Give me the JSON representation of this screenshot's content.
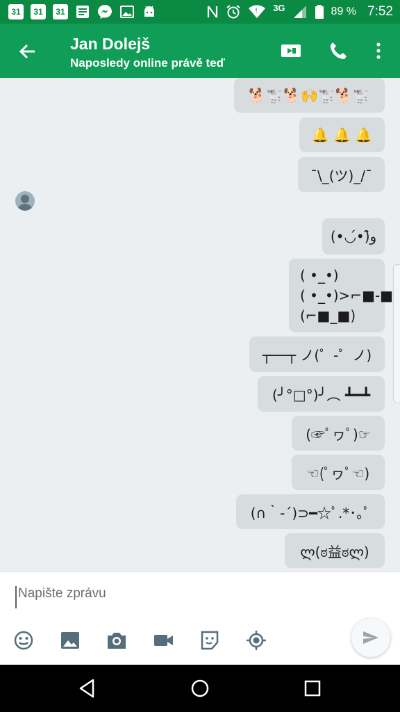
{
  "status_bar": {
    "calendar_day": "31",
    "network": "3G",
    "battery": "89 %",
    "time": "7:52",
    "left_icons": [
      "calendar-icon",
      "calendar-icon",
      "calendar-icon",
      "notes-icon",
      "messenger-icon",
      "image-icon",
      "android-icon"
    ],
    "right_icons": [
      "nfc-icon",
      "alarm-icon",
      "wifi-icon",
      "signal-icon",
      "battery-icon"
    ]
  },
  "header": {
    "contact_name": "Jan Dolejš",
    "status": "Naposledy online právě teď",
    "icons": [
      "back-arrow-icon",
      "video-call-icon",
      "phone-icon",
      "more-vert-icon"
    ]
  },
  "messages": [
    {
      "text": "🐕🐩🐕🙌🐩🐕🐩"
    },
    {
      "text": "🔔 🔔 🔔"
    },
    {
      "text": "¯\\_(ツ)_/¯"
    },
    {
      "text": "(•◡•́)و̑̑"
    },
    {
      "text": "( •_•)\n( •_•)>⌐■-■\n(⌐■_■)"
    },
    {
      "text": "┬──┬ ノ(゜-゜ノ)"
    },
    {
      "text": "(╯°□°)╯︵ ┻━┻"
    },
    {
      "text": "(☞ﾟヮﾟ)☞"
    },
    {
      "text": "☜(ﾟヮﾟ☜)"
    },
    {
      "text": "(∩｀-´)⊃━☆ﾟ.*･｡ﾟ"
    },
    {
      "text": "ლ(ಠ益ಠლ)"
    }
  ],
  "composer": {
    "placeholder": "Napište zprávu",
    "tools": [
      "emoji-icon",
      "gallery-icon",
      "camera-icon",
      "video-icon",
      "sticker-icon",
      "location-icon"
    ],
    "send_icon": "send-icon"
  },
  "colors": {
    "status_bar": "#0b8a43",
    "app_bar": "#0f9d58",
    "background": "#eceff1",
    "bubble": "#d7dcdf",
    "nav_bar": "#000000"
  }
}
